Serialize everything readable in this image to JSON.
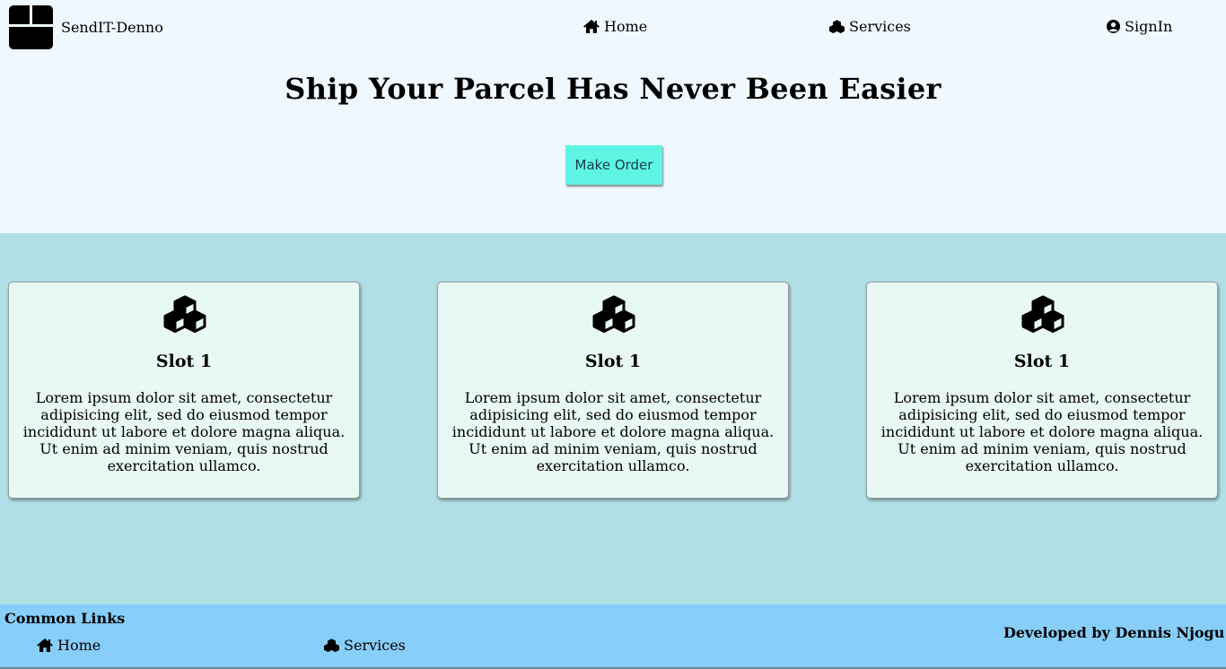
{
  "navbar": {
    "brand_name": "SendIT-Denno",
    "links": [
      {
        "label": "Home",
        "icon": "home-icon"
      },
      {
        "label": "Services",
        "icon": "cubes-icon"
      },
      {
        "label": "SignIn",
        "icon": "user-circle-icon"
      }
    ]
  },
  "hero": {
    "title": "Ship Your Parcel Has Never Been Easier",
    "button_label": "Make Order"
  },
  "slots": [
    {
      "title": "Slot 1",
      "text": "Lorem ipsum dolor sit amet, consectetur adipisicing elit, sed do eiusmod tempor incididunt ut labore et dolore magna aliqua. Ut enim ad minim veniam, quis nostrud exercitation ullamco.",
      "icon": "cubes-icon"
    },
    {
      "title": "Slot 1",
      "text": "Lorem ipsum dolor sit amet, consectetur adipisicing elit, sed do eiusmod tempor incididunt ut labore et dolore magna aliqua. Ut enim ad minim veniam, quis nostrud exercitation ullamco.",
      "icon": "cubes-icon"
    },
    {
      "title": "Slot 1",
      "text": "Lorem ipsum dolor sit amet, consectetur adipisicing elit, sed do eiusmod tempor incididunt ut labore et dolore magna aliqua. Ut enim ad minim veniam, quis nostrud exercitation ullamco.",
      "icon": "cubes-icon"
    }
  ],
  "footer": {
    "heading": "Common Links",
    "links": [
      {
        "label": "Home",
        "icon": "home-icon"
      },
      {
        "label": "Services",
        "icon": "cubes-icon"
      }
    ],
    "credit": "Developed by Dennis Njogu"
  },
  "colors": {
    "page_background": "#f0f8ff",
    "slots_background": "#b0dfe5",
    "card_background": "#e8f8f5",
    "button_background": "#5ef5e5",
    "footer_background": "#87cefa"
  }
}
